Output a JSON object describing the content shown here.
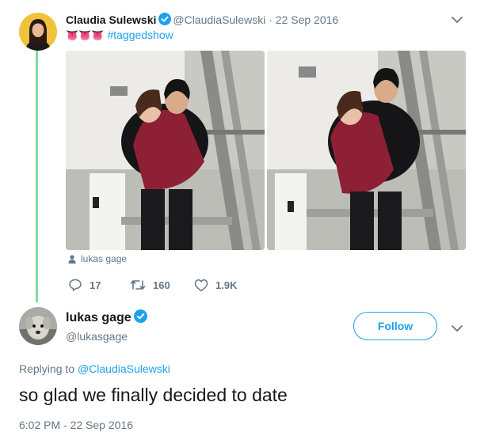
{
  "tweet": {
    "author_name": "Claudia Sulewski",
    "author_handle": "@ClaudiaSulewski",
    "separator": "·",
    "date": "22 Sep 2016",
    "emojis": "👅👅👅",
    "hashtag": "#taggedshow",
    "photo_tag": "lukas gage",
    "replies": "17",
    "retweets": "160",
    "likes": "1.9K"
  },
  "reply": {
    "author_name": "lukas gage",
    "author_handle": "@lukasgage",
    "follow_label": "Follow",
    "replying_prefix": "Replying to",
    "replying_to": "@ClaudiaSulewski",
    "text": "so glad we finally decided to date",
    "timestamp": "6:02 PM - 22 Sep 2016"
  },
  "colors": {
    "accent": "#1da1f2",
    "thread_line": "#7fdba7",
    "muted": "#657786"
  },
  "icons": [
    "verified-badge-icon",
    "chevron-down-icon",
    "reply-icon",
    "retweet-icon",
    "like-icon",
    "person-icon"
  ]
}
